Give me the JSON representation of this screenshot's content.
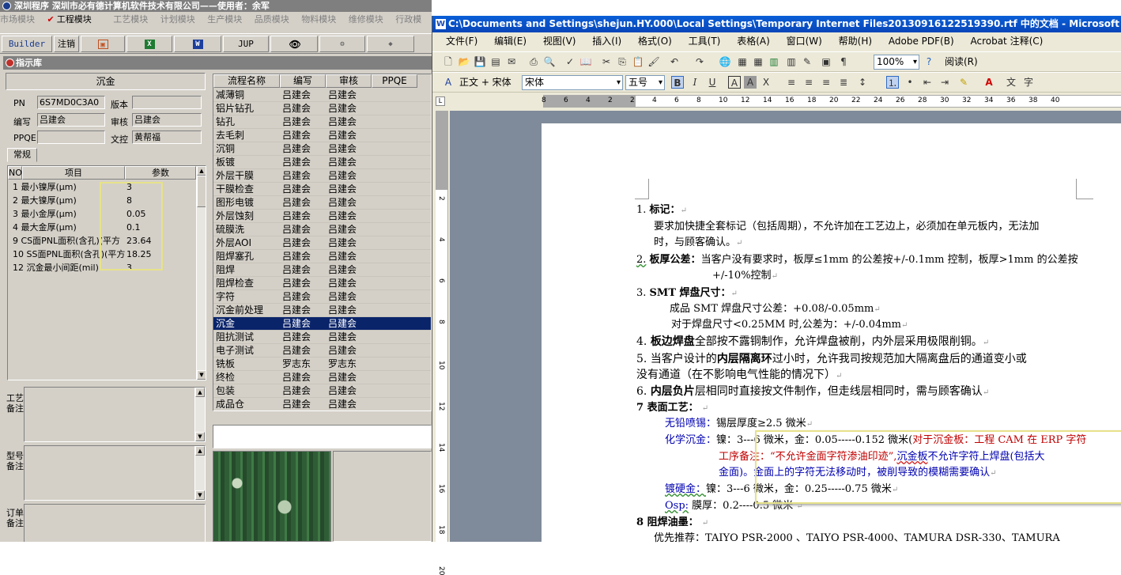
{
  "erp": {
    "title": "深圳程序   深圳市必有德计算机软件技术有限公司——使用者：余军",
    "menu": [
      "市场模块",
      "工程模块",
      "工艺模块",
      "计划模块",
      "生产模块",
      "品质模块",
      "物料模块",
      "维修模块",
      "行政模"
    ],
    "active_menu_index": 1,
    "toolbar": {
      "builder": "Builder",
      "logout": "注销",
      "jup": "JUP"
    },
    "panel_title": "指示库",
    "info": {
      "header": "沉金",
      "pn_label": "PN",
      "pn_value": "6S7MD0C3A0",
      "version_label": "版本",
      "version_value": "",
      "author_label": "编写",
      "author_value": "吕建会",
      "review_label": "审核",
      "review_value": "吕建会",
      "ppqe_label": "PPQE",
      "ppqe_value": "",
      "control_label": "文控",
      "control_value": "黄帮福"
    },
    "tab_normal": "常规",
    "param_grid": {
      "headers": [
        "NO",
        "项目",
        "参数"
      ],
      "rows": [
        {
          "name": "1 最小镍厚(μm)",
          "value": "3"
        },
        {
          "name": "2 最大镍厚(μm)",
          "value": "8"
        },
        {
          "name": "3 最小金厚(μm)",
          "value": "0.05"
        },
        {
          "name": "4 最大金厚(μm)",
          "value": "0.1"
        },
        {
          "name": "9 CS面PNL面积(含孔)(平方",
          "value": "23.64"
        },
        {
          "name": "10 SS面PNL面积(含孔)(平方",
          "value": "18.25"
        },
        {
          "name": "12 沉金最小间距(mil)",
          "value": "3"
        }
      ]
    },
    "memos": [
      "工艺备注",
      "型号备注",
      "订单备注"
    ],
    "process_grid": {
      "headers": [
        "流程名称",
        "编写",
        "审核",
        "PPQE"
      ],
      "rows": [
        [
          "减薄铜",
          "吕建会",
          "吕建会"
        ],
        [
          "铝片钻孔",
          "吕建会",
          "吕建会"
        ],
        [
          "钻孔",
          "吕建会",
          "吕建会"
        ],
        [
          "去毛刺",
          "吕建会",
          "吕建会"
        ],
        [
          "沉铜",
          "吕建会",
          "吕建会"
        ],
        [
          "板镀",
          "吕建会",
          "吕建会"
        ],
        [
          "外层干膜",
          "吕建会",
          "吕建会"
        ],
        [
          "干膜检查",
          "吕建会",
          "吕建会"
        ],
        [
          "图形电镀",
          "吕建会",
          "吕建会"
        ],
        [
          "外层蚀刻",
          "吕建会",
          "吕建会"
        ],
        [
          "硫膜洗",
          "吕建会",
          "吕建会"
        ],
        [
          "外层AOI",
          "吕建会",
          "吕建会"
        ],
        [
          "阻焊塞孔",
          "吕建会",
          "吕建会"
        ],
        [
          "阻焊",
          "吕建会",
          "吕建会"
        ],
        [
          "阻焊检查",
          "吕建会",
          "吕建会"
        ],
        [
          "字符",
          "吕建会",
          "吕建会"
        ],
        [
          "沉金前处理",
          "吕建会",
          "吕建会"
        ],
        [
          "沉金",
          "吕建会",
          "吕建会"
        ],
        [
          "阻抗测试",
          "吕建会",
          "吕建会"
        ],
        [
          "电子测试",
          "吕建会",
          "吕建会"
        ],
        [
          "铣板",
          "罗志东",
          "罗志东"
        ],
        [
          "终检",
          "吕建会",
          "吕建会"
        ],
        [
          "包装",
          "吕建会",
          "吕建会"
        ],
        [
          "成品仓",
          "吕建会",
          "吕建会"
        ]
      ],
      "selected_index": 17
    }
  },
  "word": {
    "title": "C:\\Documents and Settings\\shejun.HY.000\\Local Settings\\Temporary Internet Files20130916122519390.rtf 中的文档 - Microsoft Word",
    "menu": [
      "文件(F)",
      "编辑(E)",
      "视图(V)",
      "插入(I)",
      "格式(O)",
      "工具(T)",
      "表格(A)",
      "窗口(W)",
      "帮助(H)",
      "Adobe PDF(B)",
      "Acrobat 注释(C)"
    ],
    "zoom": "100%",
    "reading": "阅读(R)",
    "style": "正文 + 宋体",
    "font": "宋体",
    "size": "五号",
    "ruler_h": [
      "8",
      "6",
      "4",
      "2",
      "2",
      "4",
      "6",
      "8",
      "10",
      "12",
      "14",
      "16",
      "18",
      "20",
      "22",
      "24",
      "26",
      "28",
      "30",
      "32",
      "34",
      "36",
      "38",
      "40"
    ],
    "ruler_v": [
      "2",
      "4",
      "6",
      "8",
      "10",
      "12",
      "14",
      "16",
      "18",
      "20"
    ],
    "doc": {
      "l1_num": "1.",
      "l1_title": "标记：",
      "l1_a": "要求加快捷全套标记（包括周期），不允许加在工艺边上，必须加在单元板内，无法加",
      "l1_b": "时，与顾客确认。",
      "l2_num": "2.",
      "l2_title": "板厚公差：",
      "l2_a": "当客户没有要求时，板厚≤1mm 的公差按+/-0.1mm 控制，板厚>1mm 的公差按",
      "l2_b": "+/-10%控制",
      "l3_num": "3.",
      "l3_title": "SMT 焊盘尺寸：",
      "l3_a": "成品 SMT 焊盘尺寸公差：+0.08/-0.05mm",
      "l3_b": "对于焊盘尺寸<0.25MM 时,公差为：+/-0.04mm",
      "l4_num": "4.",
      "l4_title": "板边焊盘",
      "l4_rest": "全部按不露铜制作，允许焊盘被削，内外层采用极限削铜。",
      "l5_a": "5. 当客户设计的",
      "l5_b": "内层隔离环",
      "l5_c": "过小时，允许我司按规范加大隔离盘后的通道变小或",
      "l5_d": "没有通道（在不影响电气性能的情况下）",
      "l6_a": "6.",
      "l6_b": "内层负片",
      "l6_c": "层相同时直接按文件制作，但走线层相同时，需与顾客确认",
      "l7": "7 表面工艺：",
      "s1_label": "无铅喷锡：",
      "s1_text": "锡层厚度≥2.5 微米",
      "s2_label": "化学沉金：",
      "s2_a": "镍：3---6 微米，金：0.05-----0.152 微米(",
      "s2_red": "对于沉金板：工程 CAM 在 ERP 字符",
      "s2_red2": "工序备注：“不允许金面字符渗油印迹”,",
      "s2_b": "沉金板",
      "s2_c": "不允许字符上焊盘(包括大",
      "s2_d": "金面)。金面上的字符无法移动时，被削导致的模糊需要确认",
      "s3_label": "镀硬金：",
      "s3_text": "镍：3---6 微米，金：0.25-----0.75 微米",
      "s4_label": "Osp:",
      "s4_text": "膜厚：0.2----0.5 微米",
      "l8": "8 阻焊油墨：",
      "l8_a": "优先推荐：TAIYO PSR-2000 、TAIYO PSR-4000、TAMURA  DSR-330、TAMURA"
    }
  }
}
